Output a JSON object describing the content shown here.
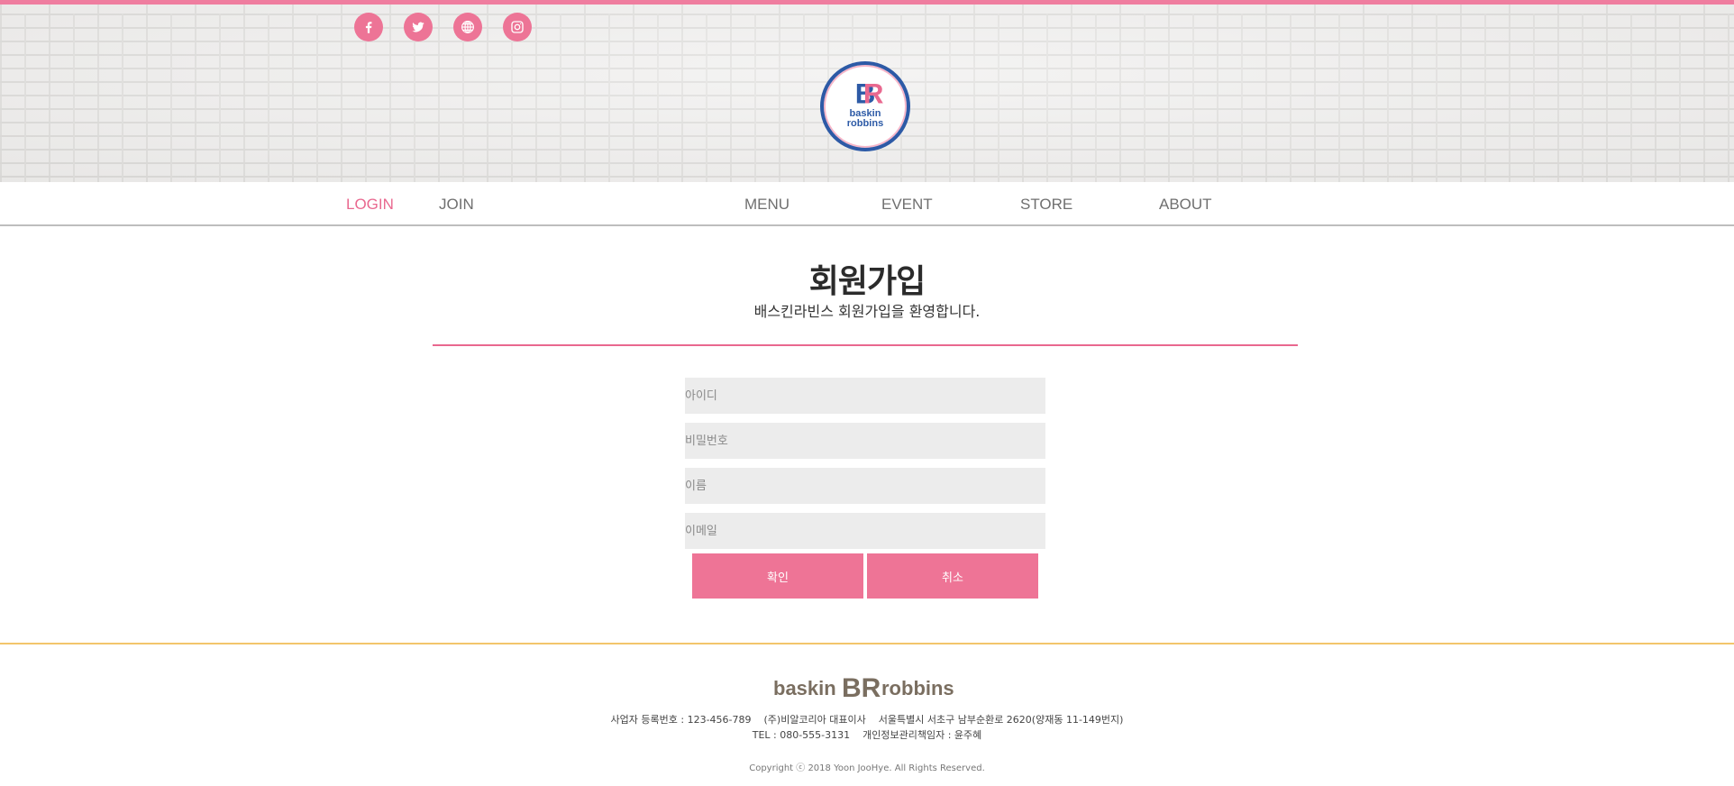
{
  "colors": {
    "accent_pink": "#ee7496",
    "nav_active": "#e9688f",
    "footer_rule": "#f3c56b",
    "field_bg": "#ececec",
    "logo_blue": "#2d5aa6"
  },
  "header": {
    "social": [
      {
        "icon": "facebook-icon"
      },
      {
        "icon": "twitter-icon"
      },
      {
        "icon": "globe-icon"
      },
      {
        "icon": "instagram-icon"
      }
    ],
    "logo": {
      "brand": "baskin robbins",
      "mark": "BR"
    }
  },
  "nav": {
    "login": "LOGIN",
    "join": "JOIN",
    "menu": "MENU",
    "event": "EVENT",
    "store": "STORE",
    "about": "ABOUT"
  },
  "main": {
    "title": "회원가입",
    "subtitle": "배스킨라빈스 회원가입을 환영합니다.",
    "fields": {
      "id_placeholder": "아이디",
      "password_placeholder": "비밀번호",
      "name_placeholder": "이름",
      "email_placeholder": "이메일"
    },
    "buttons": {
      "confirm": "확인",
      "cancel": "취소"
    }
  },
  "footer": {
    "logo_text": "baskin BR robbins",
    "line1": "사업자 등록번호 : 123-456-789    (주)비알코리아 대표이사    서울특별시 서초구 남부순환로 2620(양재동 11-149번지)",
    "line2": "TEL : 080-555-3131    개인정보관리책임자 : 윤주혜",
    "copyright": "Copyright ⓒ 2018 Yoon JooHye. All Rights Reserved."
  }
}
